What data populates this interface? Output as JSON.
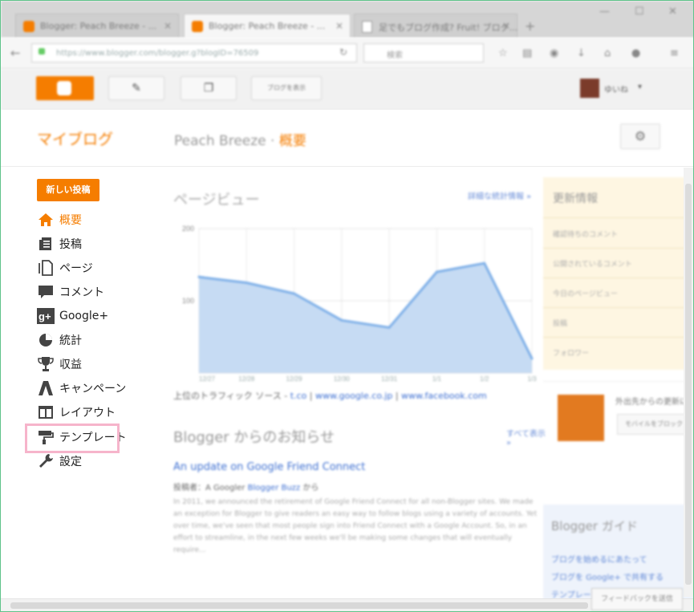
{
  "browser": {
    "tabs": [
      {
        "title": "Blogger: Peach Breeze - ...",
        "active": false
      },
      {
        "title": "Blogger: Peach Breeze - ...",
        "active": true
      },
      {
        "title": "足でもブログ作成? Fruit! ブログ...",
        "active": false
      }
    ],
    "url": "https://www.blogger.com/blogger.g?blogID=76509",
    "search_placeholder": "検索"
  },
  "header": {
    "view_blog_label": "ブログを表示",
    "user_name": "ゆいね"
  },
  "title_row": {
    "my_blog": "マイブログ",
    "blog_name": "Peach Breeze",
    "separator": "·",
    "section": "概要"
  },
  "sidebar": {
    "new_post": "新しい投稿",
    "items": [
      {
        "label": "概要",
        "icon": "home-icon",
        "active": true
      },
      {
        "label": "投稿",
        "icon": "posts-icon",
        "active": false
      },
      {
        "label": "ページ",
        "icon": "pages-icon",
        "active": false
      },
      {
        "label": "コメント",
        "icon": "comment-icon",
        "active": false
      },
      {
        "label": "Google+",
        "icon": "google-plus-icon",
        "active": false
      },
      {
        "label": "統計",
        "icon": "stats-icon",
        "active": false
      },
      {
        "label": "収益",
        "icon": "trophy-icon",
        "active": false
      },
      {
        "label": "キャンペーン",
        "icon": "adwords-icon",
        "active": false
      },
      {
        "label": "レイアウト",
        "icon": "layout-icon",
        "active": false
      },
      {
        "label": "テンプレート",
        "icon": "paint-roller-icon",
        "active": false,
        "highlighted": true
      },
      {
        "label": "設定",
        "icon": "wrench-icon",
        "active": false
      }
    ]
  },
  "main": {
    "pageviews_title": "ページビュー",
    "pageviews_link": "詳細な統計情報 »",
    "referrers_prefix": "上位のトラフィック ソース - ",
    "referrers": [
      "t.co",
      "www.google.co.jp",
      "www.facebook.com"
    ],
    "news_title": "Blogger からのお知らせ",
    "news_link": "すべて表示 »",
    "update_title": "An update on Google Friend Connect",
    "update_by_prefix": "投稿者：A Googler",
    "update_by_link": "Blogger Buzz",
    "update_by_suffix": "から",
    "update_body": "In 2011, we announced the retirement of Google Friend Connect for all non-Blogger sites. We made an exception for Blogger to give readers an easy way to follow blogs using a variety of accounts. Yet over time, we've seen that most people sign into Friend Connect with a Google Account. So, in an effort to streamline, in the next few weeks we'll be making some changes that will eventually require..."
  },
  "chart_data": {
    "type": "area",
    "x": [
      "12/27",
      "12/28",
      "12/29",
      "12/30",
      "12/31",
      "1/1",
      "1/2",
      "1/3"
    ],
    "series": [
      {
        "values": [
          133,
          125,
          110,
          73,
          63,
          140,
          152,
          20
        ]
      }
    ],
    "yticks": [
      100,
      200
    ],
    "ylim": [
      0,
      200
    ],
    "grid": true,
    "colors": {
      "line": "#7fb0e8",
      "fill": "#c6dbf3"
    }
  },
  "right_panel": {
    "title": "更新情報",
    "items": [
      "確認待ちのコメント",
      "公開されているコメント",
      "今日のページビュー",
      "投稿",
      "フォロワー"
    ],
    "promo_text": "外出先からの更新に",
    "promo_button": "モバイルをブロック",
    "guide_title": "Blogger ガイド",
    "guide_links": [
      "ブログを始めるにあたって",
      "ブログを Google+ で共有する",
      "テンプレートを選択"
    ]
  },
  "footer": {
    "feedback_button": "フィードバックを送信"
  },
  "colors": {
    "accent": "#f57d00",
    "link": "#3d6fd1",
    "highlight_border": "#f6b4cb"
  }
}
